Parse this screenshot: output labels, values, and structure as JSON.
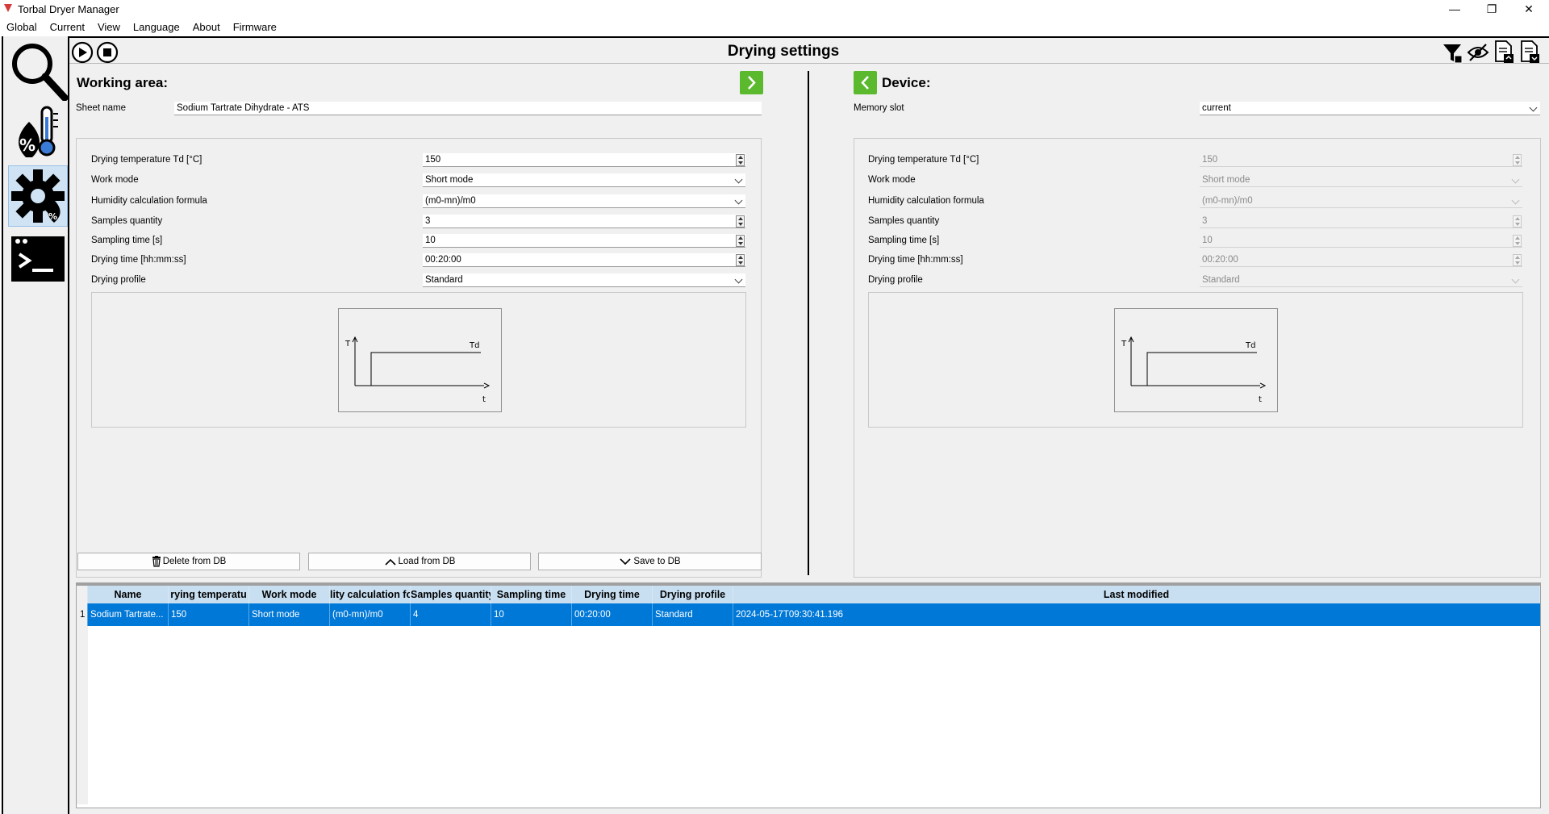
{
  "window": {
    "title": "Torbal Dryer Manager",
    "controls": {
      "minimize": "—",
      "maximize": "❐",
      "close": "✕"
    }
  },
  "menu": [
    "Global",
    "Current",
    "View",
    "Language",
    "About",
    "Firmware"
  ],
  "sidebar": {
    "items": [
      {
        "name": "search",
        "icon": "magnifier-icon",
        "active": false
      },
      {
        "name": "humidity",
        "icon": "thermometer-humidity-icon",
        "active": false
      },
      {
        "name": "drying-settings",
        "icon": "gear-humidity-icon",
        "active": true
      },
      {
        "name": "console",
        "icon": "terminal-icon",
        "active": false
      }
    ]
  },
  "toolbar": {
    "title": "Drying settings",
    "left_icons": [
      "play-icon",
      "stop-icon"
    ],
    "right_icons": [
      "filter-icon",
      "eye-hidden-icon",
      "export-doc-icon",
      "import-doc-icon"
    ]
  },
  "working_area": {
    "title": "Working area:",
    "sheet_label": "Sheet name",
    "sheet_value": "Sodium Tartrate Dihydrate - ATS",
    "fields": [
      {
        "label": "Drying temperature Td [°C]",
        "value": "150",
        "kind": "spin"
      },
      {
        "label": "Work mode",
        "value": "Short mode",
        "kind": "dropdown"
      },
      {
        "label": "Humidity calculation formula",
        "value": "(m0-mn)/m0",
        "kind": "dropdown"
      },
      {
        "label": "Samples quantity",
        "value": "3",
        "kind": "spin"
      },
      {
        "label": "Sampling time [s]",
        "value": "10",
        "kind": "spin"
      },
      {
        "label": "Drying time [hh:mm:ss]",
        "value": "00:20:00",
        "kind": "spin"
      },
      {
        "label": "Drying profile",
        "value": "Standard",
        "kind": "dropdown"
      }
    ],
    "buttons": {
      "delete": "Delete from DB",
      "load": "Load from DB",
      "save": "Save to DB"
    }
  },
  "device": {
    "title": "Device:",
    "slot_label": "Memory slot",
    "slot_value": "current",
    "fields": [
      {
        "label": "Drying temperature Td [°C]",
        "value": "150",
        "kind": "spin"
      },
      {
        "label": "Work mode",
        "value": "Short mode",
        "kind": "dropdown"
      },
      {
        "label": "Humidity calculation formula",
        "value": "(m0-mn)/m0",
        "kind": "dropdown"
      },
      {
        "label": "Samples quantity",
        "value": "3",
        "kind": "spin"
      },
      {
        "label": "Sampling time [s]",
        "value": "10",
        "kind": "spin"
      },
      {
        "label": "Drying time [hh:mm:ss]",
        "value": "00:20:00",
        "kind": "spin"
      },
      {
        "label": "Drying profile",
        "value": "Standard",
        "kind": "dropdown"
      }
    ]
  },
  "diagram": {
    "y_axis": "T",
    "x_axis": "t",
    "level_label": "Td"
  },
  "table": {
    "columns": [
      "Name",
      "rying temperatu",
      "Work mode",
      "lity calculation fo",
      "Samples quantity",
      "Sampling time",
      "Drying time",
      "Drying profile",
      "Last modified"
    ],
    "rows": [
      {
        "num": "1",
        "cells": [
          "Sodium Tartrate...",
          "150",
          "Short mode",
          "(m0-mn)/m0",
          "4",
          "10",
          "00:20:00",
          "Standard",
          "2024-05-17T09:30:41.196"
        ]
      }
    ]
  },
  "colors": {
    "accent_green": "#5bb92e",
    "selection": "#0078d7",
    "header": "#c8dff2"
  }
}
